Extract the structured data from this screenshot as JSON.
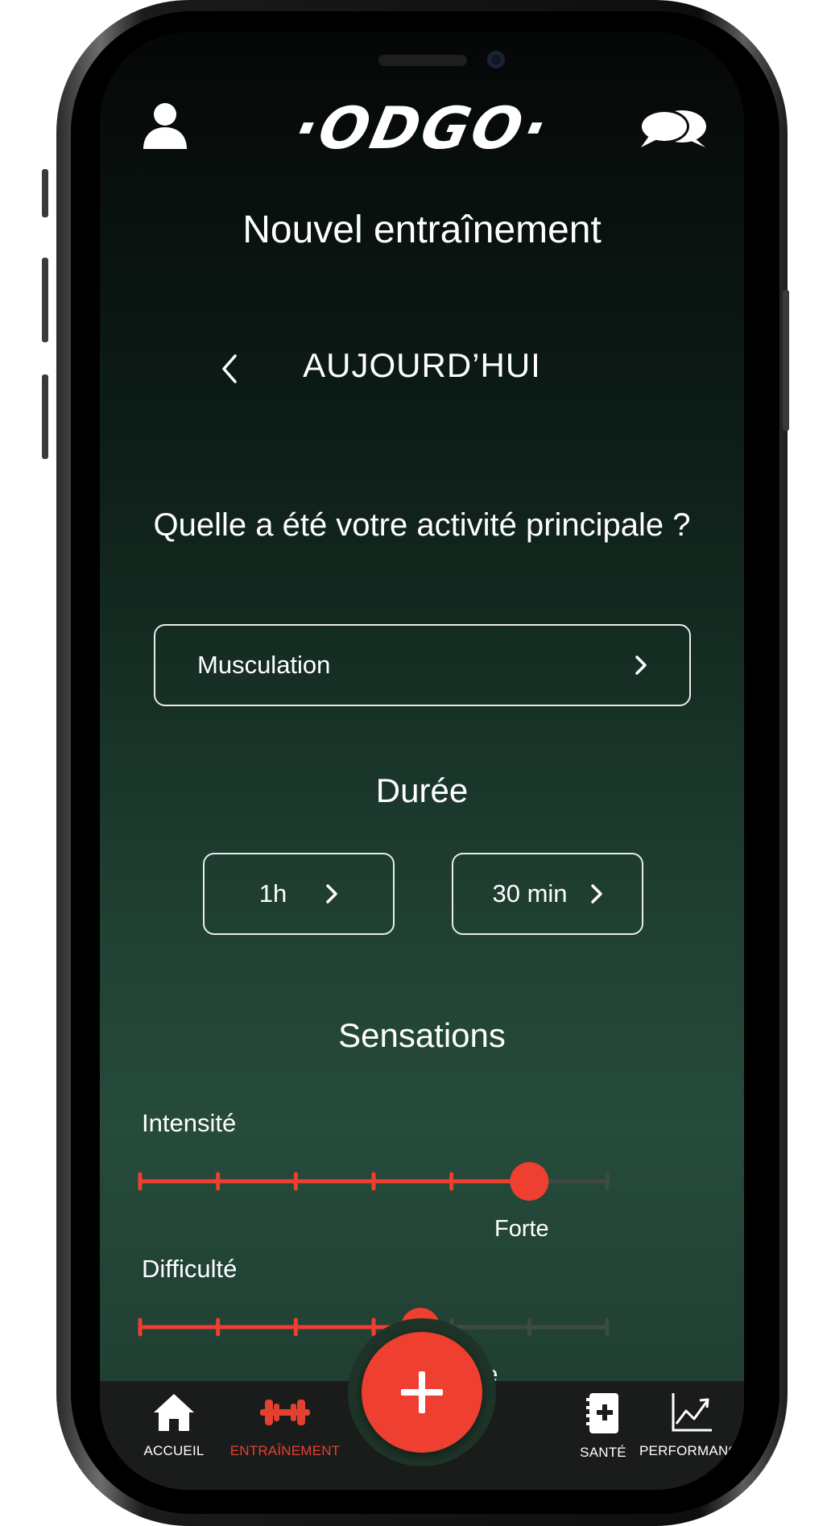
{
  "app": {
    "logo": "·ODGO·"
  },
  "page": {
    "title": "Nouvel entraînement",
    "date_label": "AUJOURD’HUI"
  },
  "activity": {
    "question": "Quelle a été votre activité principale ?",
    "selected": "Musculation"
  },
  "duration": {
    "title": "Durée",
    "hours": "1h",
    "minutes": "30 min"
  },
  "sensations": {
    "title": "Sensations",
    "intensity": {
      "label": "Intensité",
      "value_label": "Forte",
      "level": 5,
      "max_level": 6
    },
    "difficulty": {
      "label": "Difficulté",
      "value_label": "ne",
      "level": 3.6,
      "max_level": 6
    }
  },
  "tab_bar": {
    "items": [
      {
        "label": "ACCUEIL",
        "icon": "home-icon",
        "active": false
      },
      {
        "label": "ENTRAÎNEMENT",
        "icon": "dumbbell-icon",
        "active": true
      },
      {
        "label": "SANTÉ",
        "icon": "health-notebook-icon",
        "active": false
      },
      {
        "label": "PERFORMANCE",
        "icon": "chart-icon",
        "active": false
      }
    ],
    "fab_icon": "plus-icon"
  },
  "colors": {
    "accent": "#ee3f30",
    "track_inactive": "#3f4a44",
    "tab_bar_bg": "#1a1c1b"
  }
}
